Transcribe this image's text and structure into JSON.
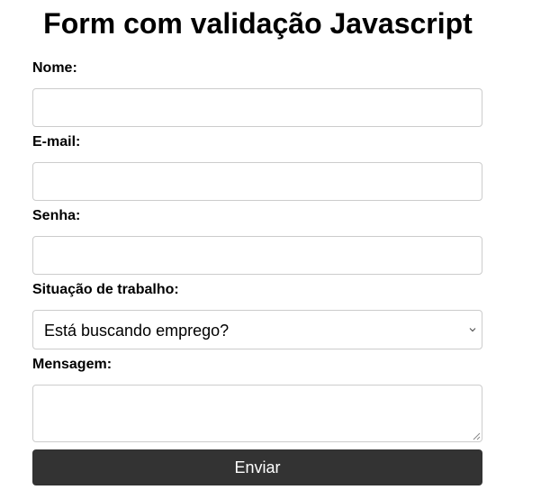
{
  "page": {
    "title": "Form com validação Javascript"
  },
  "form": {
    "name": {
      "label": "Nome:",
      "value": ""
    },
    "email": {
      "label": "E-mail:",
      "value": ""
    },
    "password": {
      "label": "Senha:",
      "value": ""
    },
    "work_status": {
      "label": "Situação de trabalho:",
      "selected": "Está buscando emprego?"
    },
    "message": {
      "label": "Mensagem:",
      "value": ""
    },
    "submit_label": "Enviar"
  },
  "colors": {
    "button_background": "#333333",
    "button_text": "#ffffff",
    "input_border": "#cccccc"
  },
  "icons": {
    "select_arrow": "chevron-down-icon",
    "textarea_resize": "resize-handle-icon"
  }
}
